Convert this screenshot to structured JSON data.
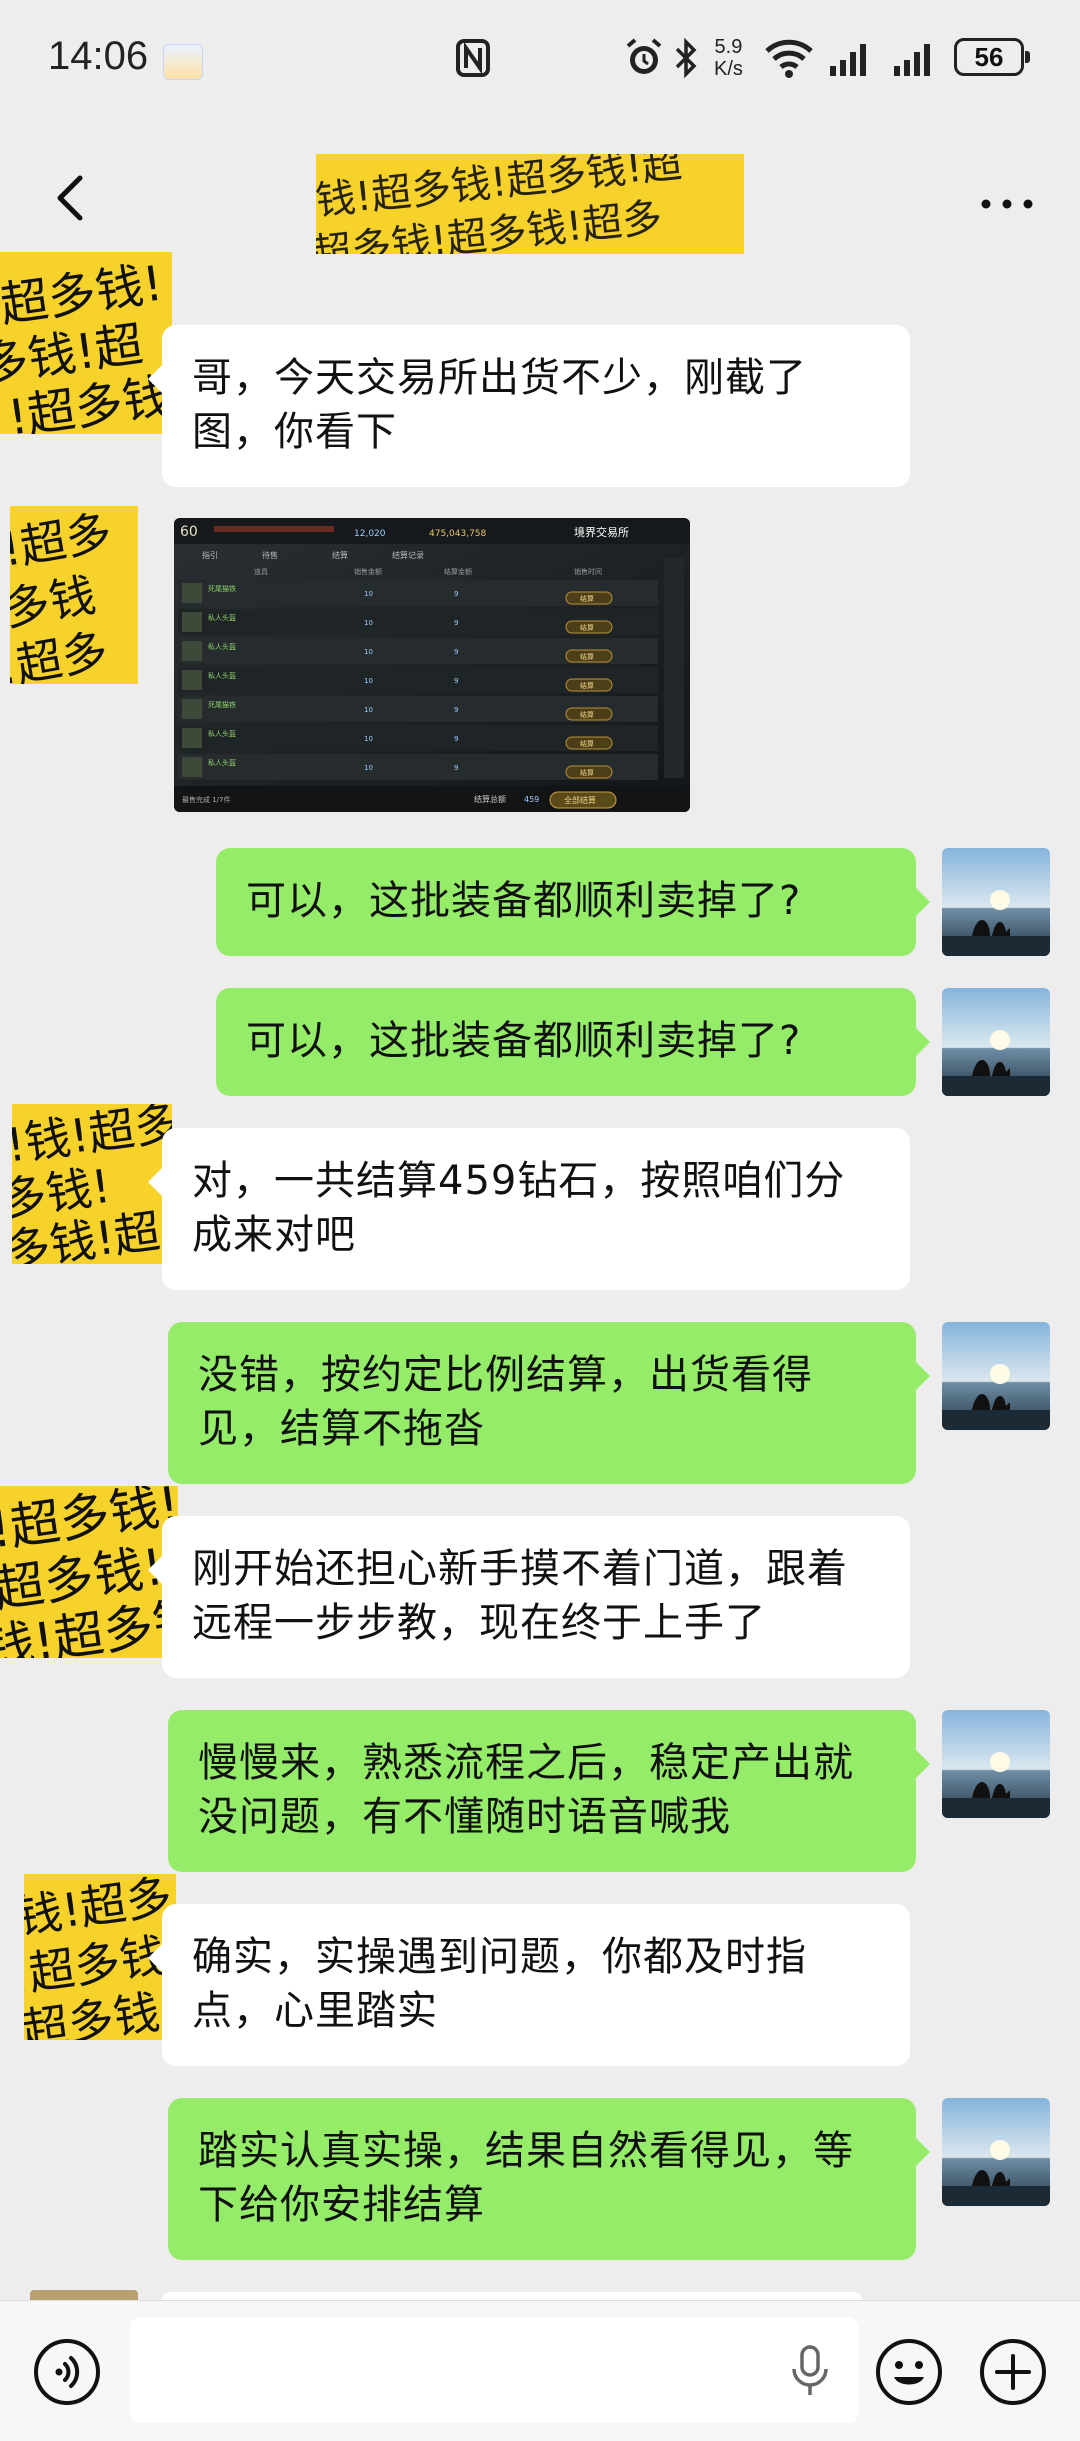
{
  "status_bar": {
    "time": "14:06",
    "speed_value": "5.9",
    "speed_unit": "K/s",
    "battery": "56",
    "icons": [
      "nfc-icon",
      "alarm-icon",
      "bluetooth-icon",
      "wifi-icon",
      "signal-icon",
      "signal-icon"
    ]
  },
  "header": {
    "back_icon": "chevron-left-icon",
    "more_icon": "more-icon",
    "title_image_text": "钱!超多钱!超多钱!超"
  },
  "messages": [
    {
      "side": "left",
      "text": "哥，今天交易所出货不少，刚截了图，你看下"
    },
    {
      "side": "left",
      "type": "image"
    },
    {
      "side": "right",
      "text": "可以，这批装备都顺利卖掉了?"
    },
    {
      "side": "right",
      "text": "可以，这批装备都顺利卖掉了?"
    },
    {
      "side": "left",
      "text": "对，一共结算459钻石，按照咱们分成来对吧"
    },
    {
      "side": "right",
      "text": "没错，按约定比例结算，出货看得见，结算不拖沓"
    },
    {
      "side": "left",
      "text": "刚开始还担心新手摸不着门道，跟着远程一步步教，现在终于上手了"
    },
    {
      "side": "right",
      "text": "慢慢来，熟悉流程之后，稳定产出就没问题，有不懂随时语音喊我"
    },
    {
      "side": "left",
      "text": "确实，实操遇到问题，你都及时指点，心里踏实"
    },
    {
      "side": "right",
      "text": "踏实认真实操，结果自然看得见，等下给你安排结算"
    }
  ],
  "screenshot": {
    "level": "60",
    "diamonds": "12,020",
    "gold": "475,043,758",
    "market_title": "境界交易所",
    "tabs": [
      "指引",
      "待售",
      "结算",
      "结算记录"
    ],
    "columns": [
      "道具",
      "销售金额",
      "结算金额",
      "销售时间"
    ],
    "rows": [
      {
        "name": "死尾猫铁",
        "price": "10",
        "settle": "9",
        "button": "结算"
      },
      {
        "name": "私人头盔",
        "price": "10",
        "settle": "9",
        "button": "结算"
      },
      {
        "name": "私人头盔",
        "price": "10",
        "settle": "9",
        "button": "结算"
      },
      {
        "name": "私人头盔",
        "price": "10",
        "settle": "9",
        "button": "结算"
      },
      {
        "name": "死尾猫铁",
        "price": "10",
        "settle": "9",
        "button": "结算"
      },
      {
        "name": "私人头盔",
        "price": "10",
        "settle": "9",
        "button": "结算"
      },
      {
        "name": "私人头盔",
        "price": "10",
        "settle": "9",
        "button": "结算"
      }
    ],
    "total_label": "结算总额",
    "total_value": "459",
    "settle_all": "全部结算",
    "footer_note": "最售完成 1/7件"
  },
  "input_bar": {
    "voice_icon": "voice-icon",
    "mic_icon": "mic-icon",
    "emoji_icon": "emoji-icon",
    "plus_icon": "plus-icon"
  },
  "colors": {
    "background": "#ededed",
    "bubble_green": "#95ec69",
    "bubble_white": "#ffffff",
    "sticker_yellow": "#f7d22b"
  }
}
